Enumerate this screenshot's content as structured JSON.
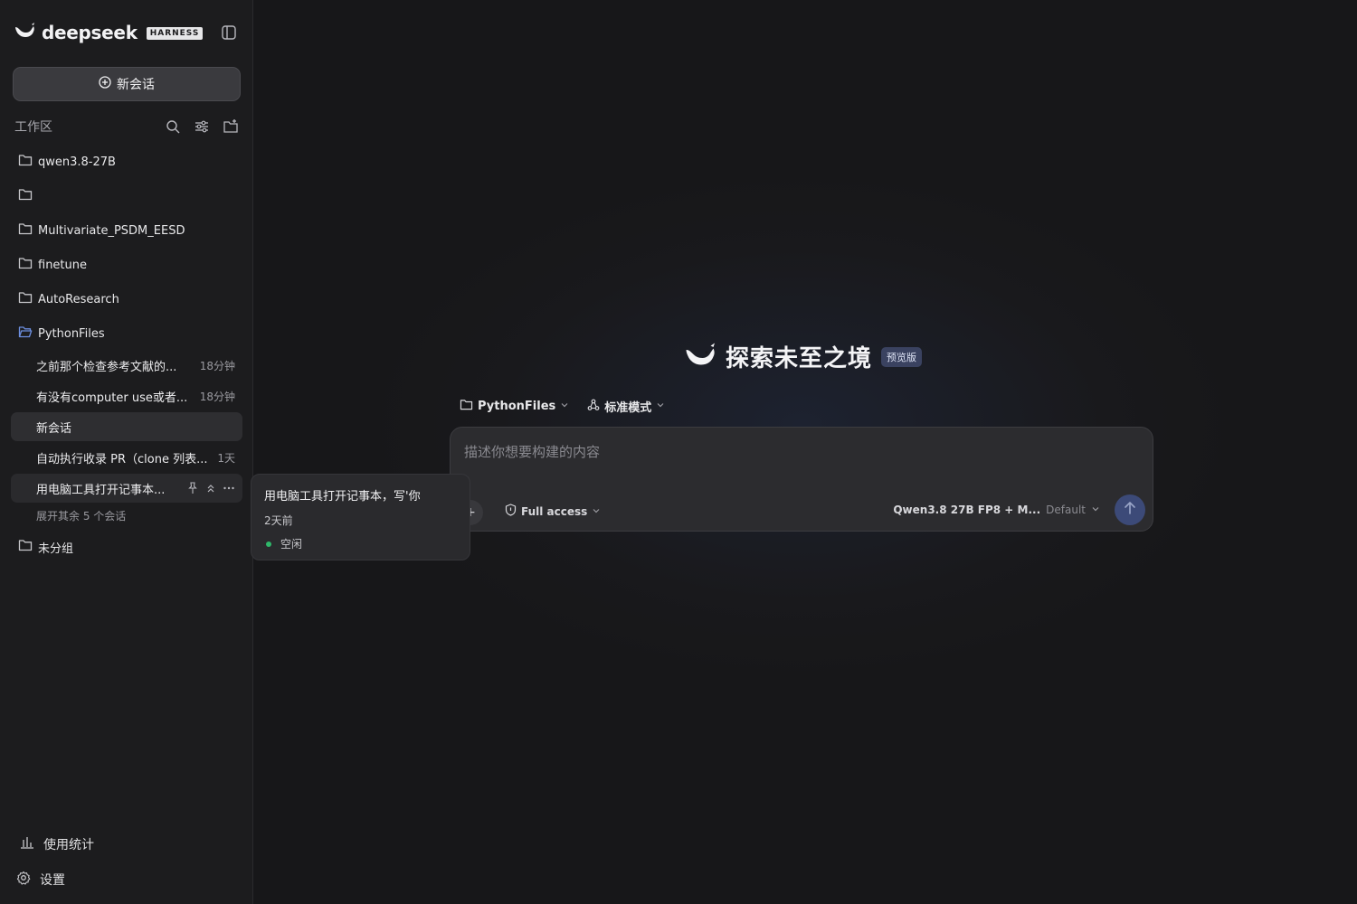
{
  "brand": {
    "name": "deepseek",
    "badge": "HARNESS"
  },
  "sidebar": {
    "new_chat_label": "新会话",
    "workspace_title": "工作区",
    "folders": [
      {
        "name": "qwen3.8-27B"
      },
      {
        "name": ""
      },
      {
        "name": "Multivariate_PSDM_EESD"
      },
      {
        "name": "finetune"
      },
      {
        "name": "AutoResearch"
      },
      {
        "name": "PythonFiles",
        "open": true
      }
    ],
    "sessions": [
      {
        "title": "之前那个检查参考文献的...",
        "time": "18分钟"
      },
      {
        "title": "有没有computer use或者...",
        "time": "18分钟"
      },
      {
        "title": "新会话",
        "time": ""
      },
      {
        "title": "自动执行收录 PR（clone 列表...",
        "time": "1天"
      },
      {
        "title": "用电脑工具打开记事本...",
        "time": ""
      }
    ],
    "expand_more": "展开其余 5 个会话",
    "ungrouped": "未分组",
    "usage_stats": "使用统计",
    "settings": "设置"
  },
  "tooltip": {
    "title": "用电脑工具打开记事本，写'你",
    "time": "2天前",
    "status": "空闲"
  },
  "main": {
    "hero_title": "探索未至之境",
    "preview_badge": "预览版",
    "workspace_selector": "PythonFiles",
    "mode_selector": "标准模式",
    "input_placeholder": "描述你想要构建的内容",
    "access_label": "Full access",
    "model_name": "Qwen3.8 27B FP8 + M...",
    "model_mode": "Default"
  },
  "colors": {
    "sidebar_bg": "#1c1c1e",
    "main_bg": "#171719",
    "accent": "#3c4a78",
    "status_idle": "#2fb86a"
  }
}
